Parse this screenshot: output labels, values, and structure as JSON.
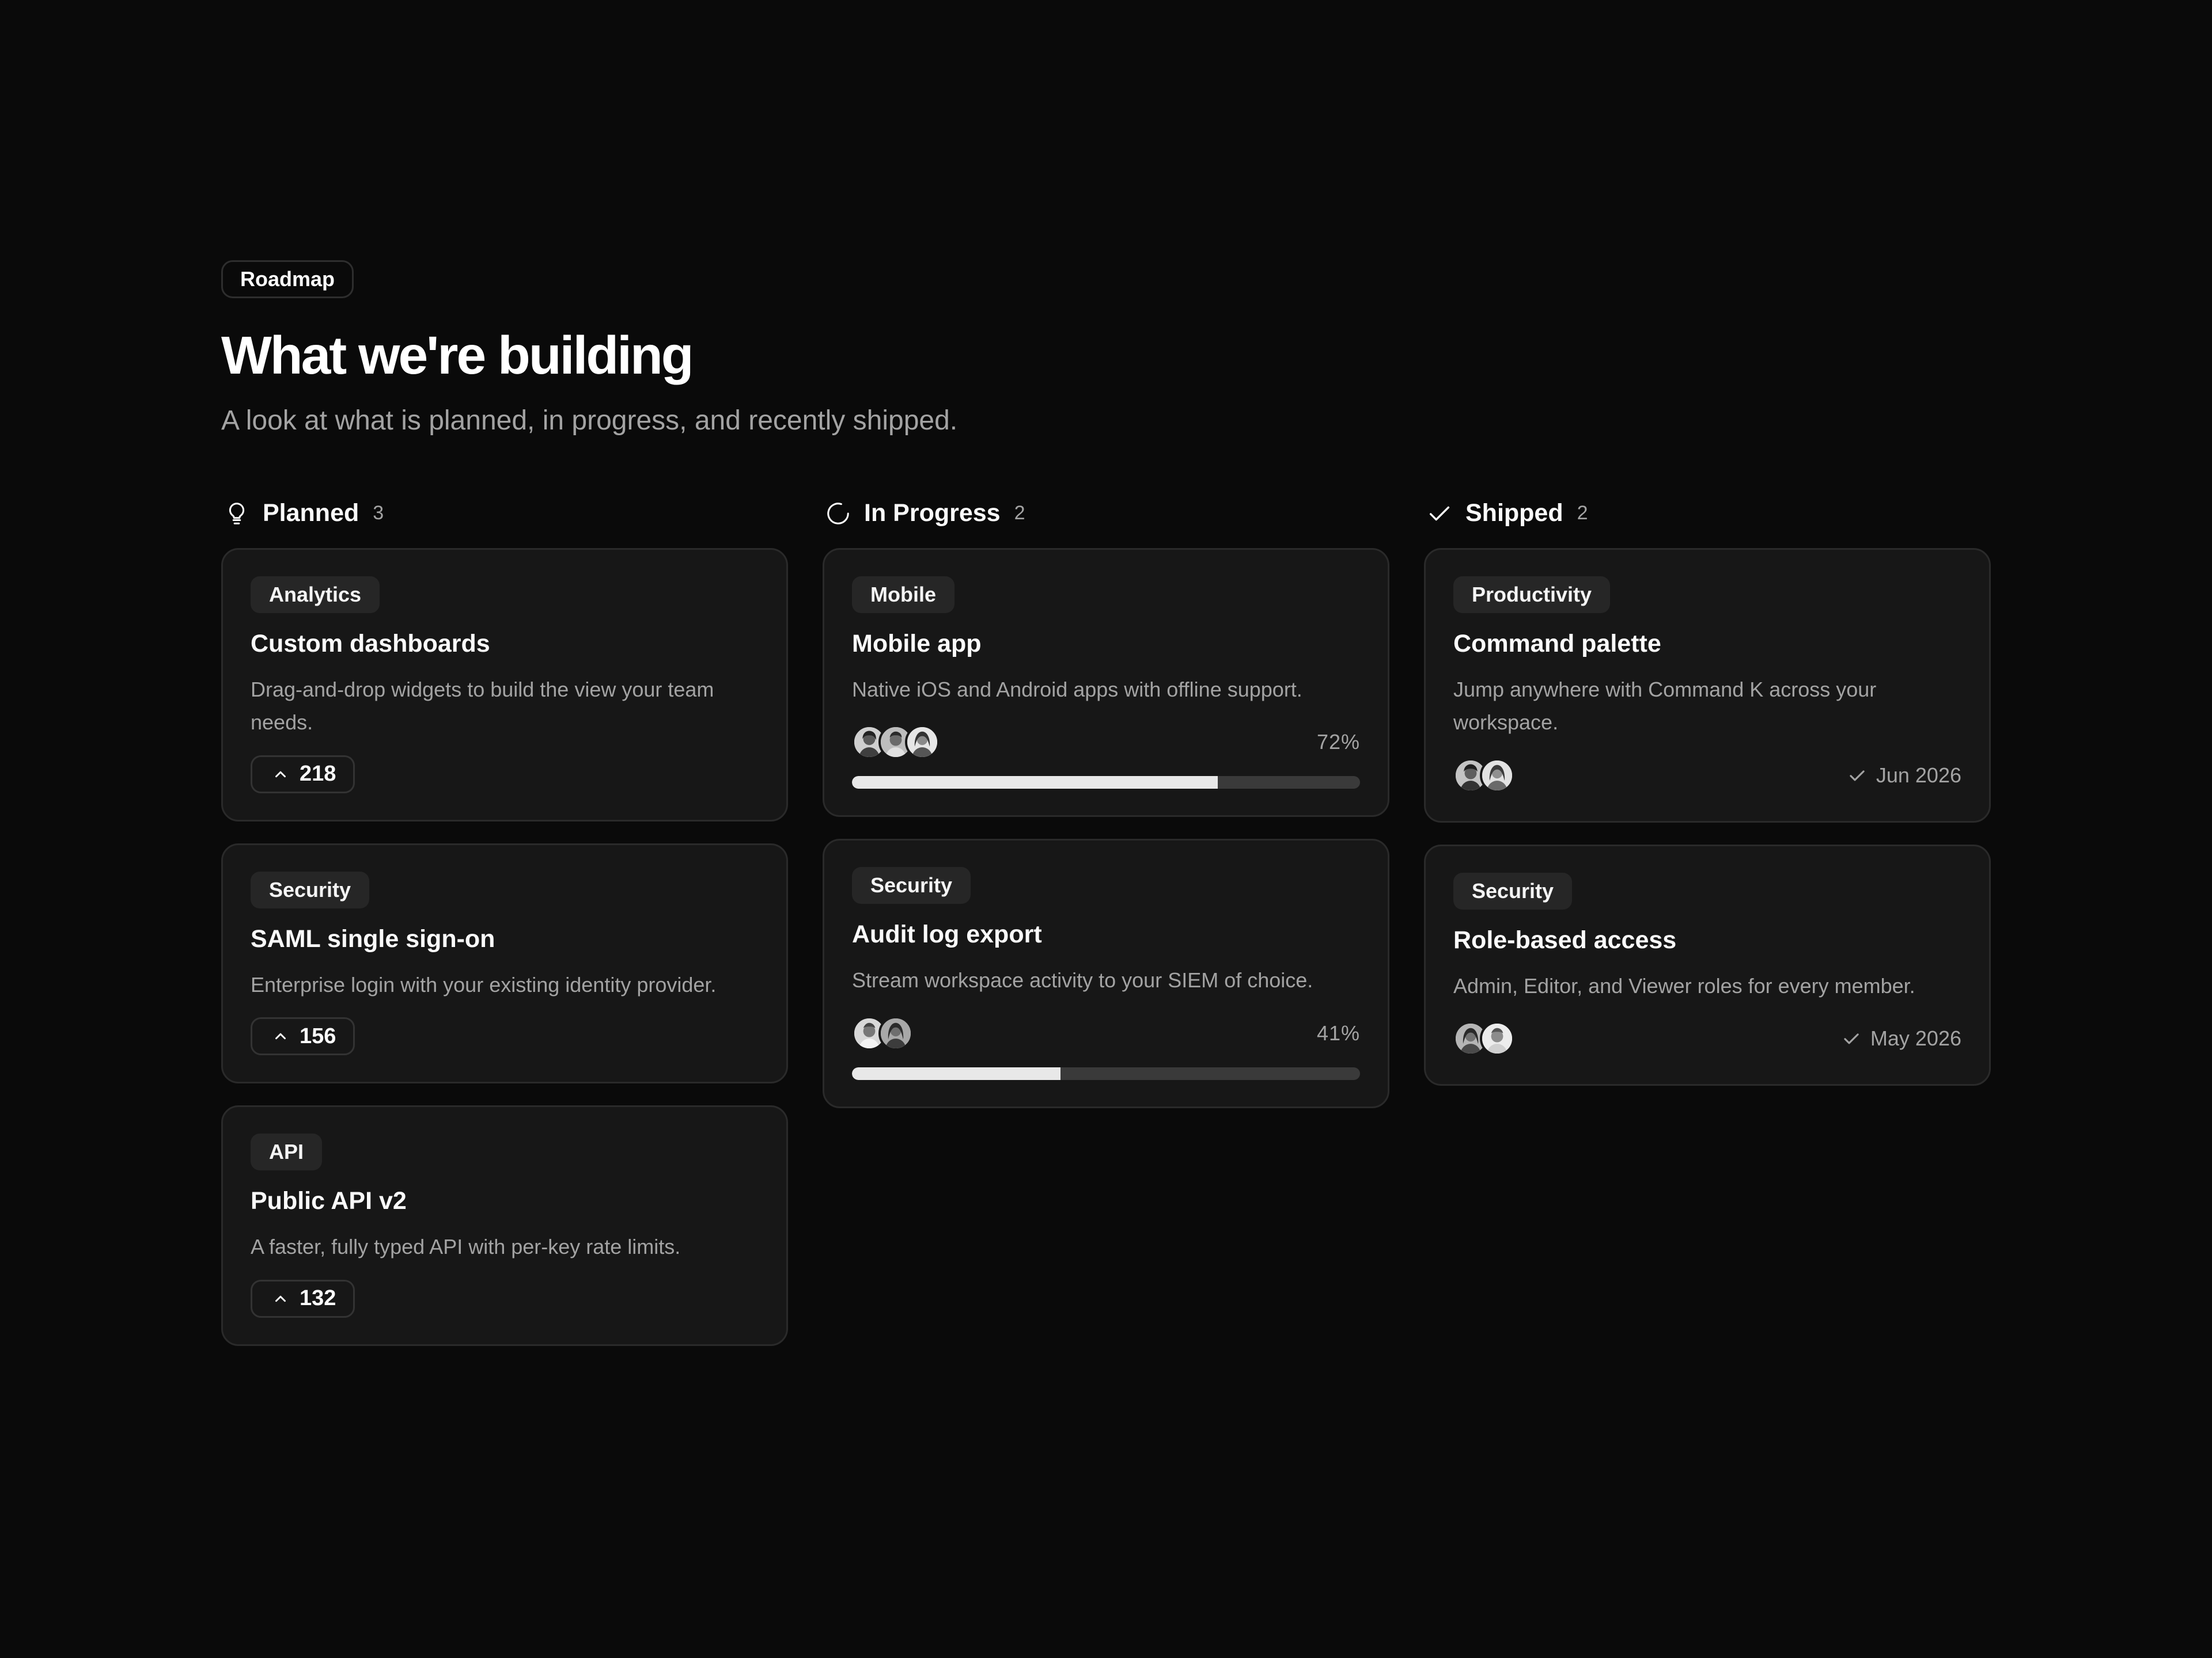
{
  "header": {
    "eyebrow": "Roadmap",
    "title": "What we're building",
    "subtitle": "A look at what is planned, in progress, and recently shipped."
  },
  "columns": [
    {
      "name": "Planned",
      "count": "3",
      "icon": "lightbulb-icon",
      "cards": [
        {
          "tag": "Analytics",
          "title": "Custom dashboards",
          "description": "Drag-and-drop widgets to build the view your team needs.",
          "votes": "218"
        },
        {
          "tag": "Security",
          "title": "SAML single sign-on",
          "description": "Enterprise login with your existing identity provider.",
          "votes": "156"
        },
        {
          "tag": "API",
          "title": "Public API v2",
          "description": "A faster, fully typed API with per-key rate limits.",
          "votes": "132"
        }
      ]
    },
    {
      "name": "In Progress",
      "count": "2",
      "icon": "spinner-icon",
      "cards": [
        {
          "tag": "Mobile",
          "title": "Mobile app",
          "description": "Native iOS and Android apps with offline support.",
          "progress": 0.72,
          "progress_label": "72%",
          "avatars": 3
        },
        {
          "tag": "Security",
          "title": "Audit log export",
          "description": "Stream workspace activity to your SIEM of choice.",
          "progress": 0.41,
          "progress_label": "41%",
          "avatars": 2
        }
      ]
    },
    {
      "name": "Shipped",
      "count": "2",
      "icon": "check-icon",
      "cards": [
        {
          "tag": "Productivity",
          "title": "Command palette",
          "description": "Jump anywhere with Command K across your workspace.",
          "shipped": "Jun 2026",
          "avatars": 2
        },
        {
          "tag": "Security",
          "title": "Role-based access",
          "description": "Admin, Editor, and Viewer roles for every member.",
          "shipped": "May 2026",
          "avatars": 2
        }
      ]
    }
  ],
  "colors": {
    "background": "#0a0a0a",
    "card": "#171717",
    "border": "#2a2a2a",
    "muted_text": "#a3a3a3",
    "progress_fill": "#e8e8e8",
    "progress_track": "#3a3a3a"
  }
}
